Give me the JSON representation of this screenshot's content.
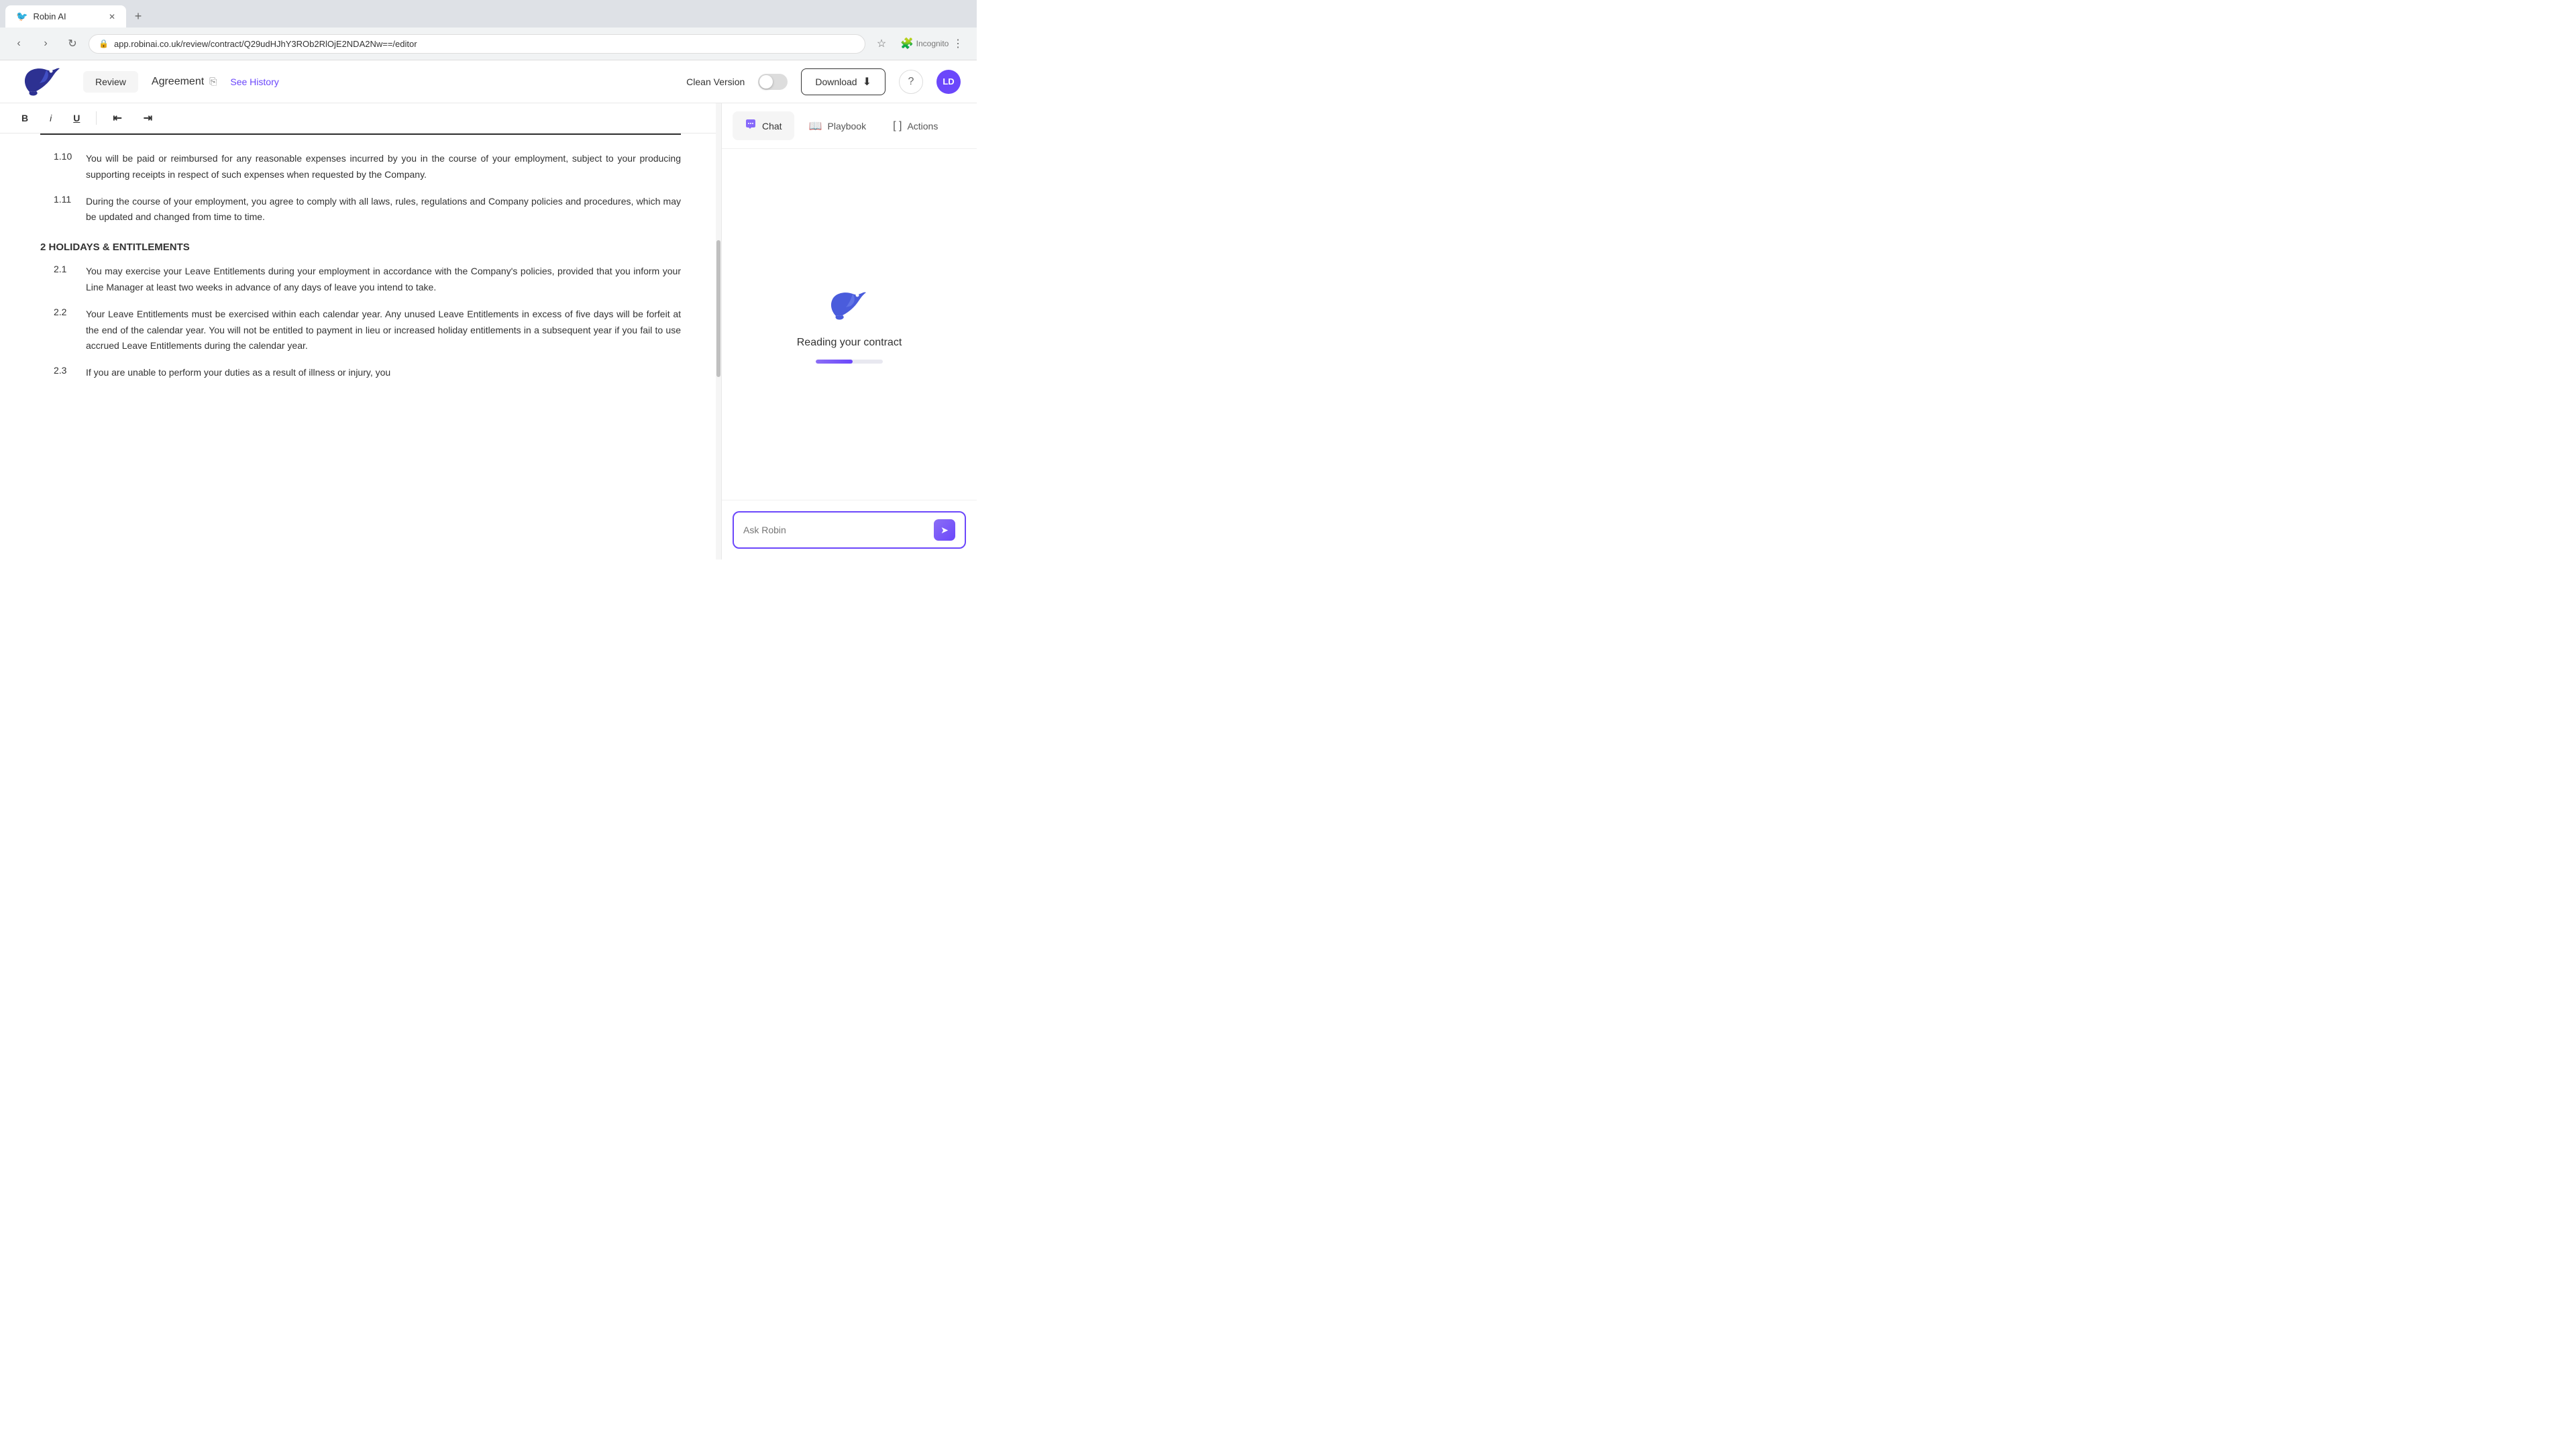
{
  "browser": {
    "tab_title": "Robin AI",
    "url": "app.robinai.co.uk/review/contract/Q29udHJhY3ROb2RlOjE2NDA2Nw==/editor",
    "incognito_label": "Incognito"
  },
  "header": {
    "review_label": "Review",
    "agreement_label": "Agreement",
    "see_history_label": "See History",
    "clean_version_label": "Clean Version",
    "download_label": "Download",
    "avatar_label": "LD"
  },
  "toolbar": {
    "bold_label": "B",
    "italic_label": "i",
    "underline_label": "U"
  },
  "document": {
    "clause_1_10_num": "1.10",
    "clause_1_10_text": "You will be paid or reimbursed for any reasonable expenses incurred by you in the course of your employment, subject to your producing supporting receipts in respect of such expenses when requested by the Company.",
    "clause_1_11_num": "1.11",
    "clause_1_11_text": "During the course of your employment, you agree to comply with all laws, rules, regulations and Company policies and procedures, which may be updated and changed from time to time.",
    "section_2_heading": "2   HOLIDAYS & ENTITLEMENTS",
    "clause_2_1_num": "2.1",
    "clause_2_1_text": "You may exercise your Leave Entitlements during your employment in accordance with the Company's policies, provided that you inform your Line Manager at least two weeks in advance of any days of leave you intend to take.",
    "clause_2_2_num": "2.2",
    "clause_2_2_text": "Your Leave Entitlements must be exercised within each calendar year. Any unused Leave Entitlements in excess of five days will be forfeit at the end of the calendar year. You will not be entitled to payment in lieu or increased holiday entitlements in a subsequent year if you fail to use accrued Leave Entitlements during the calendar year.",
    "clause_2_3_num": "2.3",
    "clause_2_3_partial": "If you are unable to perform your duties as a result of illness or injury, you"
  },
  "panel": {
    "chat_label": "Chat",
    "playbook_label": "Playbook",
    "actions_label": "Actions",
    "reading_text": "Reading your contract",
    "ask_robin_placeholder": "Ask Robin"
  }
}
